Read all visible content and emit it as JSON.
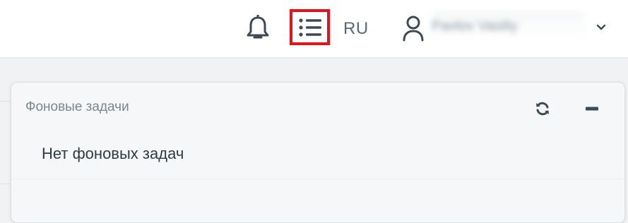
{
  "header": {
    "language": "RU",
    "user_name": "Pavlov Vasiliy",
    "icons": {
      "notifications": "bell-icon",
      "tasks": "list-icon",
      "user": "user-icon",
      "dropdown": "chevron-down-icon"
    },
    "highlight_color": "#e8101a",
    "icon_color": "#3b4a55"
  },
  "tasks_panel": {
    "title": "Фоновые задачи",
    "empty_message": "Нет фоновых задач",
    "icons": {
      "refresh": "refresh-icon",
      "minimize": "minimize-icon"
    }
  }
}
